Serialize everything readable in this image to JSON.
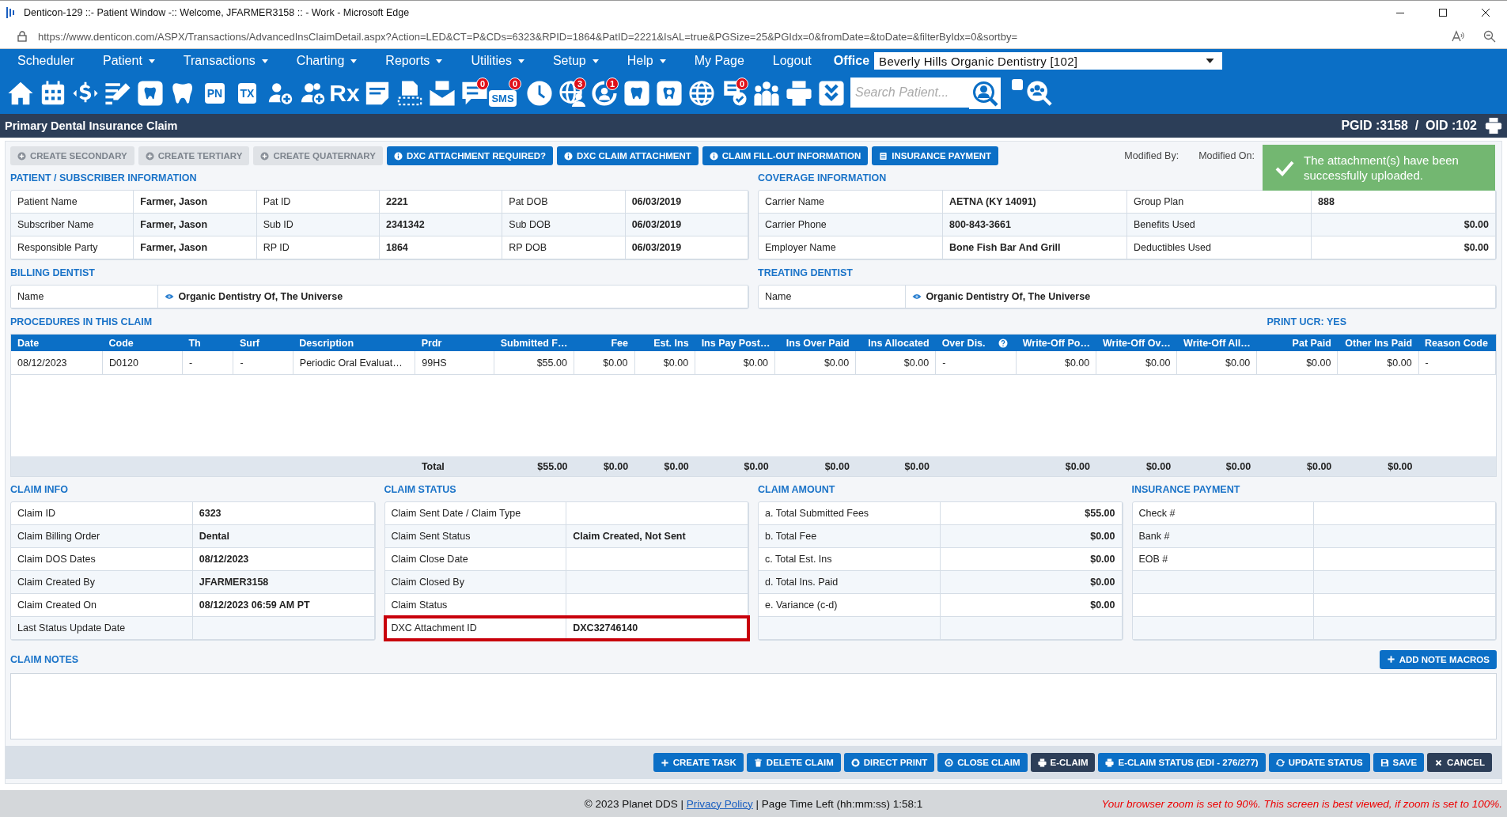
{
  "window": {
    "title": "Denticon-129 ::- Patient Window -:: Welcome, JFARMER3158 :: - Work - Microsoft Edge"
  },
  "address_bar": {
    "url": "https://www.denticon.com/ASPX/Transactions/AdvancedInsClaimDetail.aspx?Action=LED&CT=P&CDs=6323&RPID=1864&PatID=2221&IsAL=true&PGSize=25&PGIdx=0&fromDate=&toDate=&filterByIdx=0&sortby="
  },
  "menu": [
    {
      "label": "Scheduler",
      "dropdown": false
    },
    {
      "label": "Patient",
      "dropdown": true
    },
    {
      "label": "Transactions",
      "dropdown": true
    },
    {
      "label": "Charting",
      "dropdown": true
    },
    {
      "label": "Reports",
      "dropdown": true
    },
    {
      "label": "Utilities",
      "dropdown": true
    },
    {
      "label": "Setup",
      "dropdown": true
    },
    {
      "label": "Help",
      "dropdown": true
    },
    {
      "label": "My Page",
      "dropdown": false
    },
    {
      "label": "Logout",
      "dropdown": false
    }
  ],
  "office": {
    "label": "Office",
    "value": "Beverly Hills Organic Dentistry [102]"
  },
  "toolbar": [
    {
      "kind": "home"
    },
    {
      "kind": "calendar"
    },
    {
      "kind": "dollar"
    },
    {
      "kind": "edit"
    },
    {
      "kind": "tooth-card"
    },
    {
      "kind": "tooth"
    },
    {
      "kind": "label",
      "label": "PN"
    },
    {
      "kind": "label",
      "label": "TX"
    },
    {
      "kind": "person-add"
    },
    {
      "kind": "people-add"
    },
    {
      "kind": "plain-label",
      "label": "Rx"
    },
    {
      "kind": "note"
    },
    {
      "kind": "scanner"
    },
    {
      "kind": "mail"
    },
    {
      "kind": "chat",
      "badge": "0"
    },
    {
      "kind": "label",
      "label": "SMS",
      "badge": "0"
    },
    {
      "kind": "clock"
    },
    {
      "kind": "globe-person",
      "badge": "3"
    },
    {
      "kind": "refresh-person",
      "badge": "1"
    },
    {
      "kind": "tooth-card"
    },
    {
      "kind": "tooth-help"
    },
    {
      "kind": "globe"
    },
    {
      "kind": "doc-check",
      "badge": "0"
    },
    {
      "kind": "people"
    },
    {
      "kind": "printer"
    },
    {
      "kind": "chevron-box"
    }
  ],
  "search": {
    "placeholder": "Search Patient...",
    "checked": false
  },
  "header": {
    "title": "Primary Dental Insurance Claim",
    "ids": "PGID :3158  /  OID :102"
  },
  "actions": [
    {
      "label": "CREATE SECONDARY",
      "disabled": true
    },
    {
      "label": "CREATE TERTIARY",
      "disabled": true
    },
    {
      "label": "CREATE QUATERNARY",
      "disabled": true
    },
    {
      "label": "DXC ATTACHMENT REQUIRED?",
      "disabled": false
    },
    {
      "label": "DXC CLAIM ATTACHMENT",
      "disabled": false
    },
    {
      "label": "CLAIM FILL-OUT INFORMATION",
      "disabled": false
    },
    {
      "label": "INSURANCE PAYMENT",
      "disabled": false
    }
  ],
  "modified": {
    "by_label": "Modified By:",
    "on_label": "Modified On:"
  },
  "toast": {
    "message": "The attachment(s) have been successfully uploaded."
  },
  "patient": {
    "title": "PATIENT / SUBSCRIBER INFORMATION",
    "rows": [
      [
        {
          "label": "Patient Name",
          "value": "Farmer, Jason"
        },
        {
          "label": "Pat ID",
          "value": "2221"
        },
        {
          "label": "Pat DOB",
          "value": "06/03/2019"
        }
      ],
      [
        {
          "label": "Subscriber Name",
          "value": "Farmer, Jason"
        },
        {
          "label": "Sub ID",
          "value": "2341342"
        },
        {
          "label": "Sub DOB",
          "value": "06/03/2019"
        }
      ],
      [
        {
          "label": "Responsible Party",
          "value": "Farmer, Jason"
        },
        {
          "label": "RP ID",
          "value": "1864"
        },
        {
          "label": "RP DOB",
          "value": "06/03/2019"
        }
      ]
    ]
  },
  "coverage": {
    "title": "COVERAGE INFORMATION",
    "rows": [
      [
        {
          "label": "Carrier Name",
          "value": "AETNA (KY 14091)",
          "kind": "text"
        },
        {
          "label": "Group Plan",
          "value": "888",
          "kind": "text"
        }
      ],
      [
        {
          "label": "Carrier Phone",
          "value": "800-843-3661",
          "kind": "text"
        },
        {
          "label": "Benefits Used",
          "value": "$0.00",
          "kind": "amount"
        }
      ],
      [
        {
          "label": "Employer Name",
          "value": "Bone Fish Bar And Grill",
          "kind": "text"
        },
        {
          "label": "Deductibles Used",
          "value": "$0.00",
          "kind": "amount"
        }
      ]
    ]
  },
  "billing_dentist": {
    "title": "BILLING DENTIST",
    "label": "Name",
    "value": "Organic Dentistry Of, The Universe"
  },
  "treating_dentist": {
    "title": "TREATING DENTIST",
    "label": "Name",
    "value": "Organic Dentistry Of, The Universe"
  },
  "procedures": {
    "title": "PROCEDURES IN THIS CLAIM",
    "print_ucr": "PRINT UCR: YES",
    "columns": [
      "Date",
      "Code",
      "Th",
      "Surf",
      "Description",
      "Prdr",
      "Submitted F…",
      "Fee",
      "Est. Ins",
      "Ins Pay Post…",
      "Ins Over Paid",
      "Ins Allocated",
      "Over Dis.",
      "Write-Off Po…",
      "Write-Off Ov…",
      "Write-Off All…",
      "Pat Paid",
      "Other Ins Paid",
      "Reason Code"
    ],
    "rows": [
      [
        "08/12/2023",
        "D0120",
        "-",
        "-",
        "Periodic Oral Evaluat…",
        "99HS",
        "$55.00",
        "$0.00",
        "$0.00",
        "$0.00",
        "$0.00",
        "$0.00",
        "-",
        "$0.00",
        "$0.00",
        "$0.00",
        "$0.00",
        "$0.00",
        "-"
      ]
    ],
    "totals": {
      "label": "Total",
      "values": [
        "$55.00",
        "$0.00",
        "$0.00",
        "$0.00",
        "$0.00",
        "$0.00",
        "$0.00",
        "$0.00",
        "$0.00",
        "$0.00",
        "$0.00"
      ]
    }
  },
  "claim_info": {
    "title": "CLAIM INFO",
    "rows": [
      {
        "label": "Claim ID",
        "value": "6323"
      },
      {
        "label": "Claim Billing Order",
        "value": "Dental"
      },
      {
        "label": "Claim DOS Dates",
        "value": "08/12/2023"
      },
      {
        "label": "Claim Created By",
        "value": "JFARMER3158"
      },
      {
        "label": "Claim Created On",
        "value": "08/12/2023 06:59 AM PT"
      },
      {
        "label": "Last Status Update Date"
      }
    ]
  },
  "claim_status": {
    "title": "CLAIM STATUS",
    "rows": [
      {
        "label": "Claim Sent Date / Claim Type",
        "highlighted": false
      },
      {
        "label": "Claim Sent Status",
        "value": "Claim Created, Not Sent",
        "highlighted": false
      },
      {
        "label": "Claim Close Date",
        "highlighted": false
      },
      {
        "label": "Claim Closed By",
        "highlighted": false
      },
      {
        "label": "Claim Status",
        "highlighted": false
      },
      {
        "label": "DXC Attachment ID",
        "value": "DXC32746140",
        "highlighted": true
      }
    ]
  },
  "claim_amount": {
    "title": "CLAIM AMOUNT",
    "rows": [
      {
        "label": "a. Total Submitted Fees",
        "value": "$55.00"
      },
      {
        "label": "b. Total Fee",
        "value": "$0.00"
      },
      {
        "label": "c. Total Est. Ins",
        "value": "$0.00"
      },
      {
        "label": "d. Total Ins. Paid",
        "value": "$0.00"
      },
      {
        "label": "e. Variance (c-d)",
        "value": "$0.00"
      }
    ]
  },
  "insurance_payment": {
    "title": "INSURANCE PAYMENT",
    "rows": [
      {
        "label": "Check #"
      },
      {
        "label": "Bank #"
      },
      {
        "label": "EOB #"
      }
    ]
  },
  "claim_notes": {
    "title": "CLAIM NOTES",
    "macro_button": "ADD NOTE MACROS"
  },
  "bottom_buttons": [
    {
      "label": "CREATE TASK",
      "kind": "primary"
    },
    {
      "label": "DELETE CLAIM",
      "kind": "primary"
    },
    {
      "label": "DIRECT PRINT",
      "kind": "primary"
    },
    {
      "label": "CLOSE CLAIM",
      "kind": "primary"
    },
    {
      "label": "E-CLAIM",
      "kind": "dark"
    },
    {
      "label": "E-CLAIM STATUS (EDI - 276/277)",
      "kind": "primary"
    },
    {
      "label": "UPDATE STATUS",
      "kind": "primary"
    },
    {
      "label": "SAVE",
      "kind": "primary"
    },
    {
      "label": "CANCEL",
      "kind": "dark"
    }
  ],
  "footer": {
    "copyright": "© 2023 Planet DDS |",
    "link": "Privacy Policy",
    "time_left": "| Page Time Left (hh:mm:ss) 1:58:1",
    "zoom_warning": "Your browser zoom is set to 90%. This screen is best viewed, if zoom is set to 100%."
  }
}
